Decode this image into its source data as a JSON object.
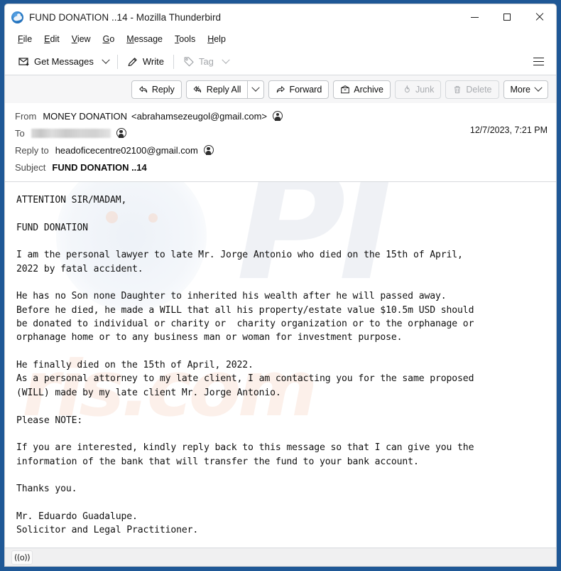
{
  "window": {
    "title": "FUND DONATION ..14 - Mozilla Thunderbird",
    "logo_icon": "thunderbird-logo-icon",
    "controls": {
      "minimize": "minimize-icon",
      "maximize": "maximize-icon",
      "close": "close-icon"
    }
  },
  "menubar": {
    "items": [
      {
        "label": "File",
        "accesskey": "F"
      },
      {
        "label": "Edit",
        "accesskey": "E"
      },
      {
        "label": "View",
        "accesskey": "V"
      },
      {
        "label": "Go",
        "accesskey": "G"
      },
      {
        "label": "Message",
        "accesskey": "M"
      },
      {
        "label": "Tools",
        "accesskey": "T"
      },
      {
        "label": "Help",
        "accesskey": "H"
      }
    ]
  },
  "toolbar": {
    "get_messages_label": "Get Messages",
    "get_messages_icon": "envelope-download-icon",
    "get_messages_caret": "chevron-down-icon",
    "write_label": "Write",
    "write_icon": "pencil-icon",
    "tag_label": "Tag",
    "tag_icon": "tag-icon",
    "tag_caret": "chevron-down-icon",
    "tag_disabled": true,
    "app_menu_icon": "hamburger-menu-icon"
  },
  "message_actions": [
    {
      "label": "Reply",
      "icon": "reply-icon",
      "disabled": false,
      "has_caret": false
    },
    {
      "label": "Reply All",
      "icon": "reply-all-icon",
      "disabled": false,
      "has_caret": true
    },
    {
      "label": "Forward",
      "icon": "forward-icon",
      "disabled": false,
      "has_caret": false
    },
    {
      "label": "Archive",
      "icon": "archive-box-icon",
      "disabled": false,
      "has_caret": false
    },
    {
      "label": "Junk",
      "icon": "junk-fire-icon",
      "disabled": true,
      "has_caret": false
    },
    {
      "label": "Delete",
      "icon": "trash-icon",
      "disabled": true,
      "has_caret": false
    },
    {
      "label": "More",
      "icon": "",
      "disabled": false,
      "has_caret": true
    }
  ],
  "header": {
    "from_label": "From",
    "from_name": "MONEY DONATION",
    "from_address": "<abrahamsezeugol@gmail.com>",
    "to_label": "To",
    "to_value_redacted": true,
    "reply_to_label": "Reply to",
    "reply_to_address": "headoficecentre02100@gmail.com",
    "subject_label": "Subject",
    "subject_value": "FUND DONATION ..14",
    "date": "12/7/2023, 7:21 PM",
    "contact_icon": "contact-person-icon"
  },
  "body": {
    "text": "ATTENTION SIR/MADAM,\n\nFUND DONATION\n\nI am the personal lawyer to late Mr. Jorge Antonio who died on the 15th of April,\n2022 by fatal accident.\n\nHe has no Son none Daughter to inherited his wealth after he will passed away.\nBefore he died, he made a WILL that all his property/estate value $10.5m USD should\nbe donated to individual or charity or  charity organization or to the orphanage or\norphanage home or to any business man or woman for investment purpose.\n\nHe finally died on the 15th of April, 2022.\nAs a personal attorney to my late client, I am contacting you for the same proposed\n(WILL) made by my late client Mr. Jorge Antonio.\n\nPlease NOTE:\n\nIf you are interested, kindly reply back to this message so that I can give you the\ninformation of the bank that will transfer the fund to your bank account.\n\nThanks you.\n\nMr. Eduardo Guadalupe.\nSolicitor and Legal Practitioner."
  },
  "watermark": {
    "mark_primary": "PI",
    "mark_secondary": "ris.com"
  },
  "statusbar": {
    "online_indicator": "((o))",
    "online_icon": "broadcast-online-icon"
  },
  "colors": {
    "window_border": "#1f5896",
    "toolbar_bg": "#f6f6f7",
    "body_bg": "#ffffff",
    "text": "#101010"
  }
}
